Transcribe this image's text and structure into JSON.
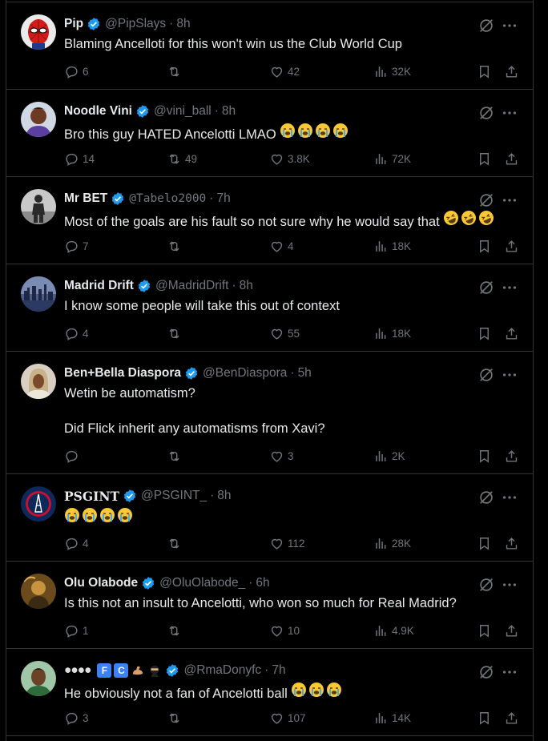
{
  "posts": [
    {
      "name": "Pip",
      "handle": "@PipSlays",
      "time": "8h",
      "lines": [
        "Blaming Ancelloti for this won't win us the Club World Cup"
      ],
      "emoji": [],
      "reply": "6",
      "repost": "",
      "like": "42",
      "views": "32K",
      "avatar": "spiderman-avatar"
    },
    {
      "name": "Noodle Vini",
      "handle": "@vini_ball",
      "time": "8h",
      "lines": [
        "Bro this guy HATED Ancelotti LMAO"
      ],
      "emoji": [
        "loudly-crying-face",
        "loudly-crying-face",
        "loudly-crying-face",
        "loudly-crying-face"
      ],
      "reply": "14",
      "repost": "49",
      "like": "3.8K",
      "views": "72K",
      "avatar": "player-avatar"
    },
    {
      "name": "Mr BET",
      "handle": "@Tabelo2000",
      "time": "7h",
      "lines": [
        "Most of the goals are his fault so not sure why he would say that"
      ],
      "emoji": [
        "rolling-laughing-face",
        "rolling-laughing-face",
        "rolling-laughing-face"
      ],
      "reply": "7",
      "repost": "",
      "like": "4",
      "views": "18K",
      "avatar": "statue-avatar"
    },
    {
      "name": "Madrid Drift",
      "handle": "@MadridDrift",
      "time": "8h",
      "lines": [
        "I know some people will take this out of context"
      ],
      "emoji": [],
      "reply": "4",
      "repost": "",
      "like": "55",
      "views": "18K",
      "avatar": "city-avatar"
    },
    {
      "name": "Ben+Bella Diaspora",
      "handle": "@BenDiaspora",
      "time": "5h",
      "lines": [
        "Wetin be automatism?",
        "Did Flick inherit any automatisms from Xavi?"
      ],
      "emoji": [],
      "reply": "",
      "repost": "",
      "like": "3",
      "views": "2K",
      "avatar": "woman-avatar"
    },
    {
      "name": "PSGINT",
      "handle": "@PSGINT_",
      "time": "8h",
      "lines": [
        ""
      ],
      "emoji": [
        "loudly-crying-face",
        "loudly-crying-face",
        "loudly-crying-face",
        "loudly-crying-face"
      ],
      "reply": "4",
      "repost": "",
      "like": "112",
      "views": "28K",
      "avatar": "psg-crest-avatar"
    },
    {
      "name": "Olu Olabode",
      "handle": "@OluOlabode_",
      "time": "6h",
      "lines": [
        "Is this not an insult to Ancelotti, who won so much for Real Madrid?"
      ],
      "emoji": [],
      "reply": "1",
      "repost": "",
      "like": "10",
      "views": "4.9K",
      "avatar": "portrait-avatar"
    },
    {
      "name": "●●●●",
      "handle": "@RmaDonyfc",
      "time": "7h",
      "lines": [
        "He obviously not a fan of Ancelotti ball"
      ],
      "emoji": [
        "loudly-crying-face",
        "loudly-crying-face",
        "loudly-crying-face"
      ],
      "reply": "3",
      "repost": "",
      "like": "107",
      "views": "14K",
      "avatar": "cartoon-avatar",
      "name_boxes": [
        "F",
        "C"
      ]
    }
  ],
  "sep": "·",
  "colors": {
    "background": "#000000",
    "text": "#e7e9ea",
    "muted": "#71767b",
    "border": "#2f3336",
    "verified": "#1d9bf0"
  }
}
